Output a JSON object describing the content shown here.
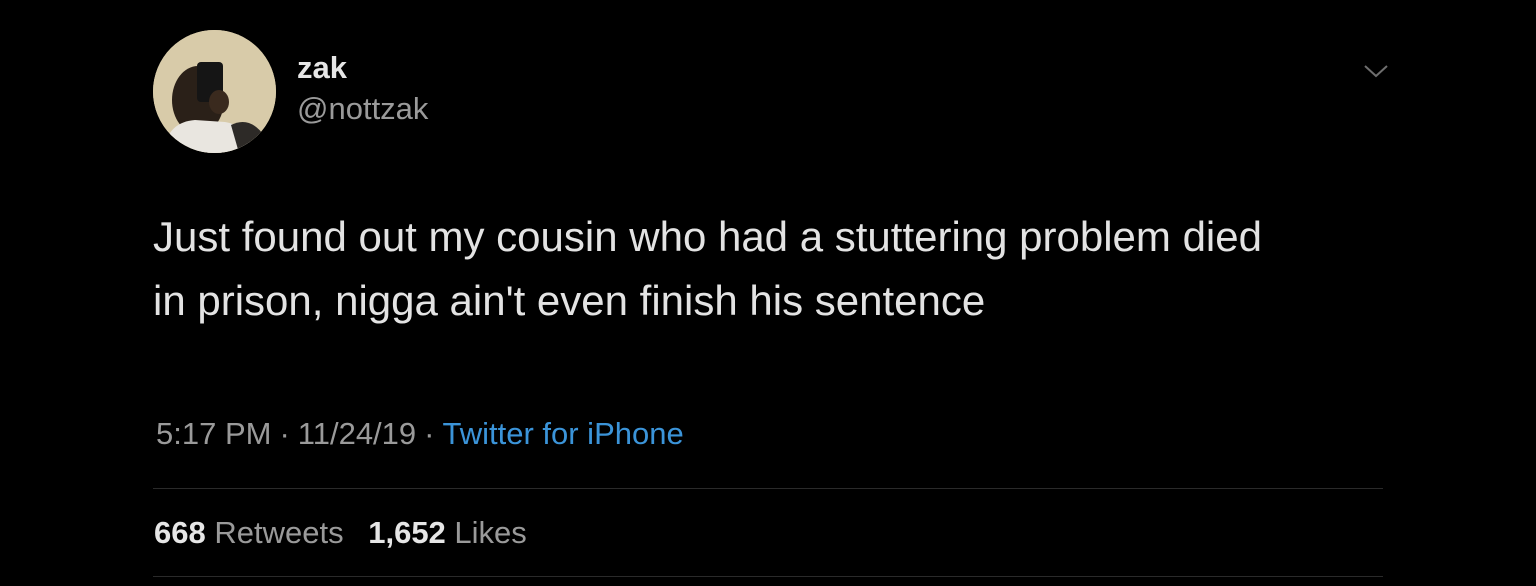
{
  "user": {
    "display_name": "zak",
    "handle": "@nottzak"
  },
  "tweet": {
    "text_lines": [
      "Just found out my cousin who had a stuttering problem died",
      "in prison, nigga ain't even finish his sentence"
    ],
    "time": "5:17 PM",
    "separator": "·",
    "date": "11/24/19",
    "source": "Twitter for iPhone"
  },
  "stats": {
    "retweets_count": "668",
    "retweets_label": "Retweets",
    "likes_count": "1,652",
    "likes_label": "Likes"
  },
  "icons": {
    "menu": "chevron-down-icon"
  },
  "colors": {
    "background": "#000000",
    "link": "#3b94d9",
    "muted_text": "#9a9a9a",
    "text": "#e3e3e3"
  }
}
